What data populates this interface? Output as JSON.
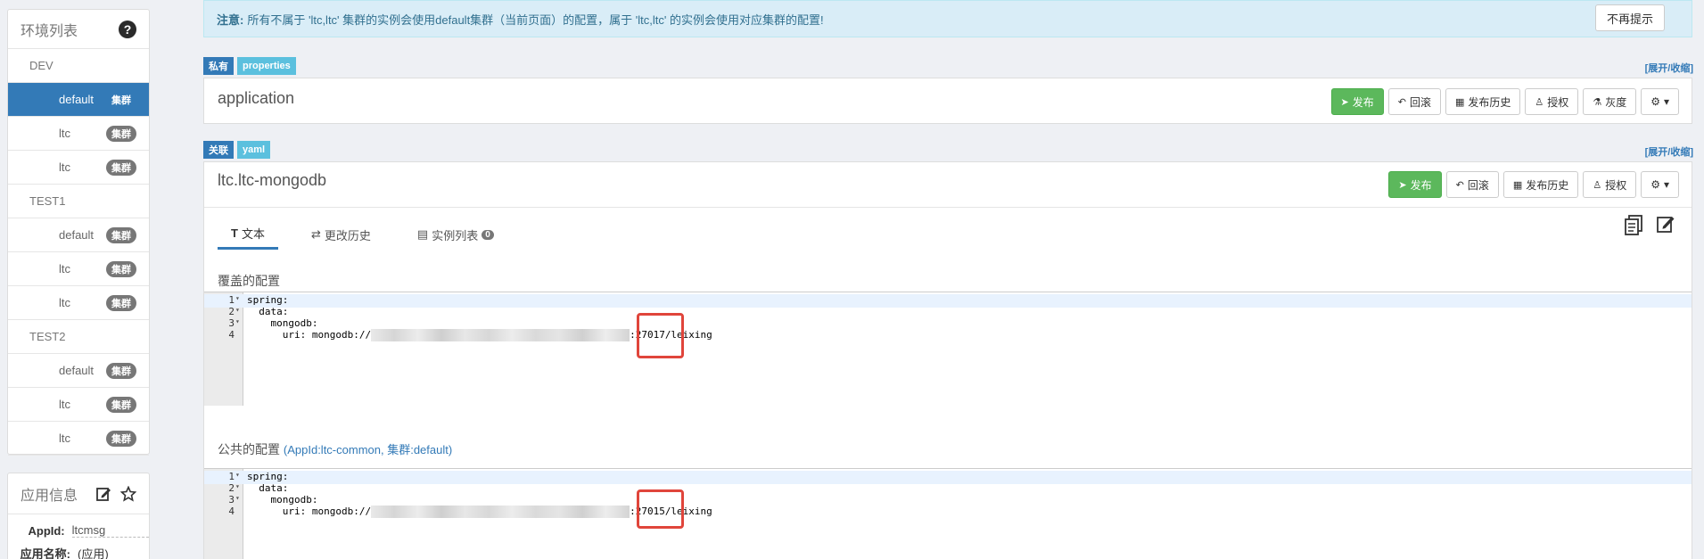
{
  "sidebar": {
    "env_title": "环境列表",
    "groups": [
      {
        "env": "DEV",
        "clusters": [
          {
            "name": "default",
            "badge": "集群",
            "active": true
          },
          {
            "name": "ltc",
            "badge": "集群"
          },
          {
            "name": "ltc",
            "badge": "集群"
          }
        ]
      },
      {
        "env": "TEST1",
        "clusters": [
          {
            "name": "default",
            "badge": "集群"
          },
          {
            "name": "ltc",
            "badge": "集群"
          },
          {
            "name": "ltc",
            "badge": "集群"
          }
        ]
      },
      {
        "env": "TEST2",
        "clusters": [
          {
            "name": "default",
            "badge": "集群"
          },
          {
            "name": "ltc",
            "badge": "集群"
          },
          {
            "name": "ltc",
            "badge": "集群"
          }
        ]
      }
    ],
    "app_title": "应用信息",
    "app_id_label": "AppId:",
    "app_id_value": "ltcmsg",
    "app_name_label": "应用名称:",
    "app_name_value": "(应用)"
  },
  "notice": {
    "prefix": "注意:",
    "text": "所有不属于 'ltc,ltc' 集群的实例会使用default集群（当前页面）的配置，属于 'ltc,ltc' 的实例会使用对应集群的配置!",
    "dismiss": "不再提示"
  },
  "ns1": {
    "tag1": "私有",
    "tag2": "properties",
    "toggle": "[展开/收缩]",
    "title": "application",
    "buttons": {
      "publish": "发布",
      "rollback": "回滚",
      "history": "发布历史",
      "auth": "授权",
      "gray": "灰度"
    }
  },
  "ns2": {
    "tag1": "关联",
    "tag2": "yaml",
    "toggle": "[展开/收缩]",
    "title": "ltc.ltc-mongodb",
    "buttons": {
      "publish": "发布",
      "rollback": "回滚",
      "history": "发布历史",
      "auth": "授权"
    },
    "tabs": {
      "text": "文本",
      "history": "更改历史",
      "instances": "实例列表",
      "instance_count": "0"
    },
    "override_label": "覆盖的配置",
    "public_label": "公共的配置",
    "public_sub": "(AppId:ltc-common, 集群:default)",
    "override_lines": [
      {
        "num": "1",
        "code": "spring:"
      },
      {
        "num": "2",
        "code": "  data:"
      },
      {
        "num": "3",
        "code": "    mongodb:"
      },
      {
        "num": "4",
        "code": "      uri: mongodb://",
        "tail": ":27017/leixing"
      }
    ],
    "public_lines": [
      {
        "num": "1",
        "code": "spring:"
      },
      {
        "num": "2",
        "code": "  data:"
      },
      {
        "num": "3",
        "code": "    mongodb:"
      },
      {
        "num": "4",
        "code": "      uri: mongodb://",
        "tail": ":27015/leixing"
      }
    ]
  }
}
